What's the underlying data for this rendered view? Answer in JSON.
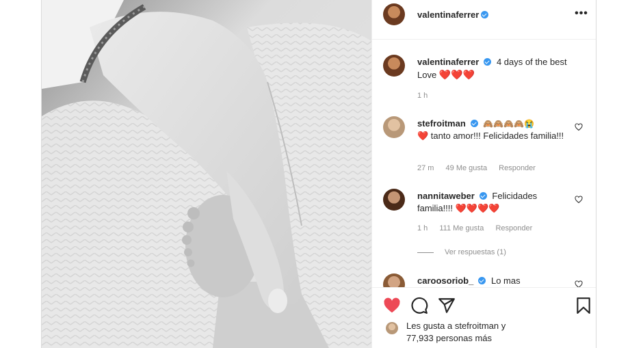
{
  "header": {
    "username": "valentinaferrer",
    "more_icon": "more-horizontal-icon"
  },
  "caption": {
    "username": "valentinaferrer",
    "text": "4 days of the best Love",
    "hearts": "❤️❤️❤️",
    "time": "1 h"
  },
  "comments": [
    {
      "username": "stefroitman",
      "emojis": "🙈🙈🙈🙈😭",
      "text": "❤️ tanto amor!!! Felicidades familia!!!",
      "time": "27 m",
      "likes": "49 Me gusta",
      "reply": "Responder"
    },
    {
      "username": "nannitaweber",
      "text": "Felicidades familia!!!! ❤️❤️❤️❤️",
      "time": "1 h",
      "likes": "111 Me gusta",
      "reply": "Responder",
      "view_replies": "Ver respuestas (1)"
    },
    {
      "username": "caroosoriob_",
      "text": "Lo mas"
    }
  ],
  "actions": {
    "like_icon": "heart-filled-icon",
    "comment_icon": "comment-icon",
    "share_icon": "send-icon",
    "save_icon": "bookmark-icon"
  },
  "likes_summary": {
    "line1": "Les gusta a stefroitman y",
    "line2": "77,933 personas más"
  },
  "colors": {
    "accent": "#ed4956",
    "verified": "#3897f0",
    "muted": "#8e8e8e"
  }
}
